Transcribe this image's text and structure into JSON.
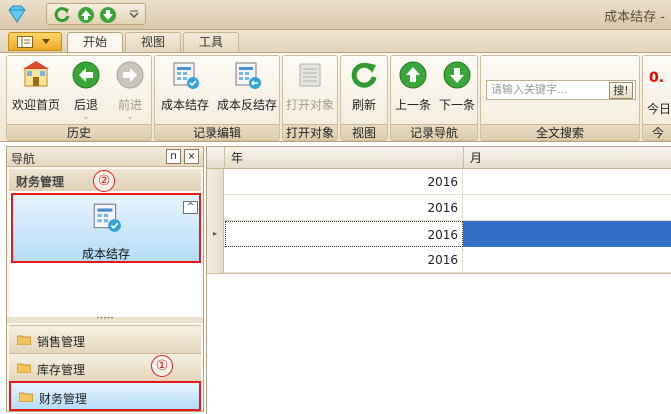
{
  "window": {
    "title": "成本结存 -"
  },
  "tabs": [
    {
      "label": "开始",
      "active": true
    },
    {
      "label": "视图",
      "active": false
    },
    {
      "label": "工具",
      "active": false
    }
  ],
  "ribbon": {
    "groups": {
      "history": {
        "label": "历史",
        "buttons": [
          {
            "label": "欢迎首页",
            "icon": "home-icon"
          },
          {
            "label": "后退",
            "icon": "back-arrow-icon"
          },
          {
            "label": "前进",
            "icon": "forward-arrow-icon",
            "disabled": true
          }
        ]
      },
      "record_edit": {
        "label": "记录编辑",
        "buttons": [
          {
            "label": "成本结存",
            "icon": "cost-settle-icon"
          },
          {
            "label": "成本反结存",
            "icon": "cost-unsettle-icon"
          }
        ]
      },
      "open_object": {
        "label": "打开对象",
        "buttons": [
          {
            "label": "打开对象",
            "icon": "open-object-icon",
            "disabled": true
          }
        ]
      },
      "view": {
        "label": "视图",
        "buttons": [
          {
            "label": "刷新",
            "icon": "refresh-icon"
          }
        ]
      },
      "record_nav": {
        "label": "记录导航",
        "buttons": [
          {
            "label": "上一条",
            "icon": "up-arrow-icon"
          },
          {
            "label": "下一条",
            "icon": "down-arrow-icon"
          }
        ]
      },
      "fulltext": {
        "label": "全文搜索",
        "placeholder": "请输入关键字...",
        "search_btn": "搜!"
      },
      "extra": {
        "label": "今",
        "number": "0.",
        "today": "今日"
      }
    }
  },
  "nav": {
    "title": "导航",
    "pin": "п",
    "close": "×",
    "group_title": "财务管理",
    "selected_item": "成本结存",
    "collapse_glyph": "^",
    "splitter": "•••••",
    "bottom_items": [
      "销售管理",
      "库存管理",
      "财务管理"
    ],
    "callouts": [
      "①",
      "②"
    ]
  },
  "grid": {
    "columns": [
      "年",
      "月"
    ],
    "rows": [
      {
        "year": "2016",
        "month": ""
      },
      {
        "year": "2016",
        "month": ""
      },
      {
        "year": "2016",
        "month": "",
        "focused": true
      },
      {
        "year": "2016",
        "month": ""
      }
    ],
    "row_indicator": "▸"
  },
  "colors": {
    "accent": "#3370c8",
    "callout": "#e41b1b",
    "ribbon_border": "#b8a27c"
  }
}
